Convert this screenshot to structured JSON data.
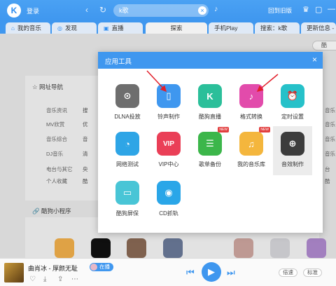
{
  "titlebar": {
    "logo": "K",
    "login": "登录",
    "search_value": "k歌",
    "old_version": "回到旧版",
    "icons": [
      "back-icon",
      "forward-icon",
      "refresh-icon",
      "clear-icon",
      "mic-icon",
      "skin-icon",
      "message-icon",
      "minimize-icon"
    ]
  },
  "tabs": [
    {
      "label": "我的音乐",
      "icon": "home-icon"
    },
    {
      "label": "发现",
      "icon": "compass-icon"
    },
    {
      "label": "直播",
      "icon": "live-icon"
    },
    {
      "label": "探索",
      "active": true
    },
    {
      "label": "手机Play"
    },
    {
      "label": "搜索：k歌"
    },
    {
      "label": "更新信息 - 酷狗"
    }
  ],
  "background": {
    "nav_title": "网址导航",
    "nav_rows": [
      "音乐资讯",
      "MV欣赏",
      "音乐综合",
      "DJ音乐",
      "电台与其它",
      "个人收藏"
    ],
    "sites": [
      "搜",
      "优",
      "音",
      "清",
      "央",
      "酷"
    ],
    "mini_title": "酷狗小程序",
    "right_labels": [
      "音乐",
      "音乐",
      "音乐",
      "音乐",
      "台",
      "酷"
    ],
    "corner_button": "酷"
  },
  "dialog": {
    "title": "应用工具",
    "tools": [
      {
        "label": "DLNA投放",
        "icon": "dlna-icon",
        "color": "#6e6e6e"
      },
      {
        "label": "铃声制作",
        "icon": "ringtone-icon",
        "color": "#3f97ef"
      },
      {
        "label": "酷狗直播",
        "icon": "kugou-live-icon",
        "color": "#2bbf9a"
      },
      {
        "label": "格式转换",
        "icon": "format-convert-icon",
        "color": "#e24bab"
      },
      {
        "label": "定时设置",
        "icon": "alarm-clock-icon",
        "color": "#26c1c9"
      },
      {
        "label": "网络测试",
        "icon": "speed-test-icon",
        "color": "#2ea5e6"
      },
      {
        "label": "VIP中心",
        "icon": "vip-icon",
        "color": "#ea3f57"
      },
      {
        "label": "歌单备份",
        "icon": "playlist-backup-icon",
        "color": "#3cb64a",
        "badge": "NEW"
      },
      {
        "label": "我的音乐库",
        "icon": "music-library-icon",
        "color": "#f4b63d",
        "badge": "NEW"
      },
      {
        "label": "音效制作",
        "icon": "sound-effect-icon",
        "color": "#3c3c3c",
        "selected": true
      },
      {
        "label": "酷狗屏保",
        "icon": "screensaver-icon",
        "color": "#49c5d6"
      },
      {
        "label": "CD抓轨",
        "icon": "cd-rip-icon",
        "color": "#2aa6e8"
      }
    ]
  },
  "player": {
    "song": "曲肖冰 - 厚颜无耻",
    "live_badge": "在播",
    "speed": "倍速",
    "quality": "标准",
    "accent": "#3f97ef"
  }
}
